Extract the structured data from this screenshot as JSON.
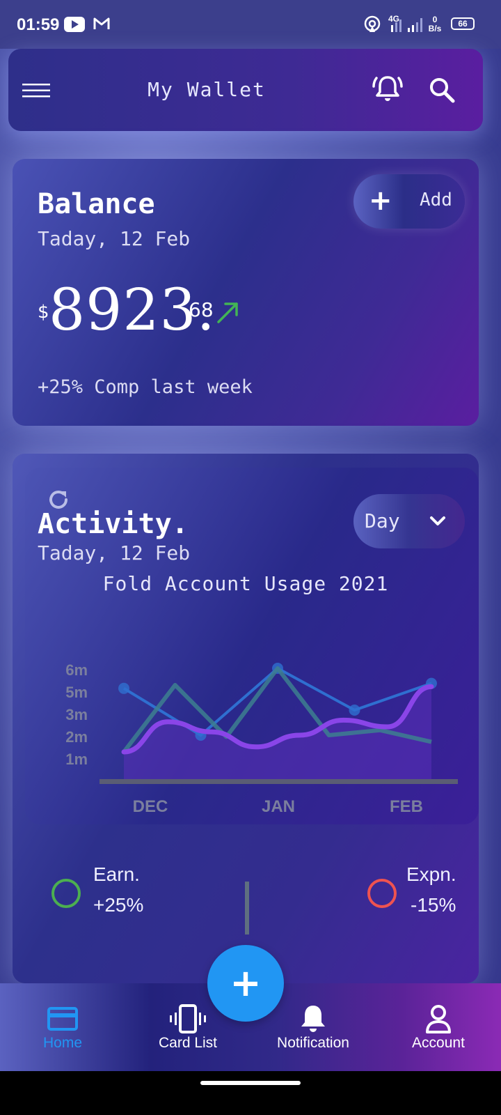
{
  "status_bar": {
    "time": "01:59",
    "network_type": "4G",
    "speed_value": "0",
    "speed_unit": "B/s",
    "battery": "66"
  },
  "header": {
    "title": "My Wallet"
  },
  "balance": {
    "title": "Balance",
    "date": "Taday, 12 Feb",
    "add_label": "Add",
    "currency_symbol": "$",
    "amount_integer": "8923.",
    "amount_decimal": "68",
    "comparison": "+25% Comp last week"
  },
  "activity": {
    "title": "Activity.",
    "date": "Taday, 12 Feb",
    "period": "Day",
    "chart_title": "Fold Account Usage 2021",
    "earn_label": "Earn.",
    "earn_value": "+25%",
    "expense_label": "Expn.",
    "expense_value": "-15%"
  },
  "chart_data": {
    "type": "line",
    "title": "Fold Account Usage 2021",
    "x_ticks": [
      "DEC",
      "JAN",
      "FEB"
    ],
    "y_ticks": [
      "6m",
      "5m",
      "3m",
      "2m",
      "1m"
    ],
    "series": [
      {
        "color": "#2f6fd0",
        "points": [
          4.8,
          2.0,
          6.0,
          3.5,
          5.1
        ]
      },
      {
        "color": "#3d7f8f",
        "points": [
          1.0,
          5.0,
          1.9,
          6.0,
          2.0,
          2.3,
          1.6
        ]
      },
      {
        "color": "#8a45e8",
        "points": [
          1.0,
          2.8,
          2.2,
          1.3,
          2.0,
          2.9,
          2.5,
          4.9
        ]
      }
    ]
  },
  "nav": {
    "items": [
      {
        "label": "Home"
      },
      {
        "label": "Card List"
      },
      {
        "label": "Notification"
      },
      {
        "label": "Account"
      }
    ],
    "active_color": "#2196f3"
  }
}
